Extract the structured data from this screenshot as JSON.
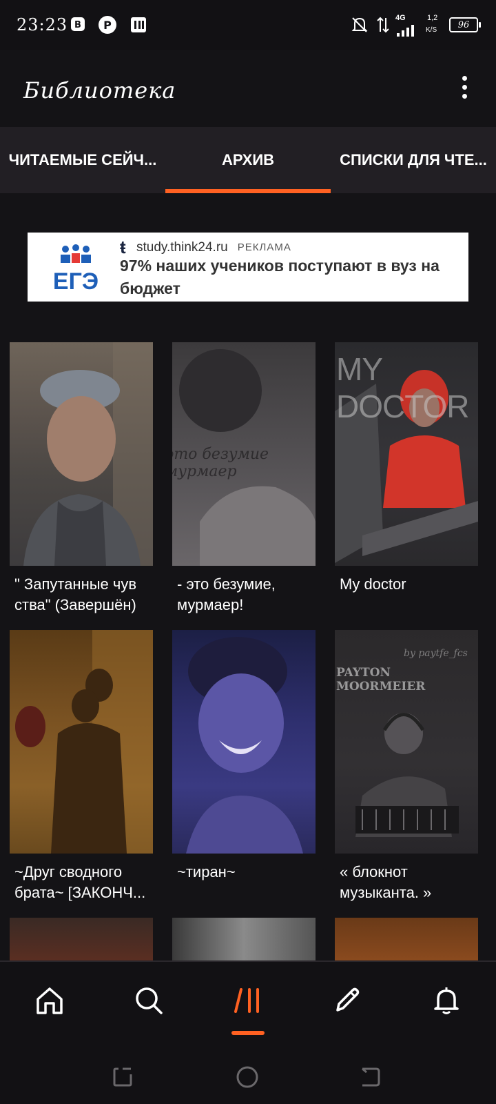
{
  "status_bar": {
    "time": "23:23",
    "network_speed": "1,2",
    "network_unit": "K/S",
    "signal_type": "4G",
    "battery": "96"
  },
  "header": {
    "title": "Библиотека"
  },
  "tabs": [
    {
      "label": "ЧИТАЕМЫЕ СЕЙЧ..."
    },
    {
      "label": "АРХИВ"
    },
    {
      "label": "СПИСКИ ДЛЯ ЧТЕ..."
    }
  ],
  "active_tab_index": 1,
  "ad": {
    "logo_text": "ЕГЭ",
    "domain": "study.think24.ru",
    "tag": "РЕКЛАМА",
    "text": "97% наших учеников поступают в вуз на бюджет"
  },
  "books": [
    {
      "title": "\" Запутанные чув ства\" (Завершён)"
    },
    {
      "title": "- это безумие, мурмаер!",
      "cover_text": "это безумие мурмаер"
    },
    {
      "title": "My doctor",
      "cover_text": "MY DOCTOR"
    },
    {
      "title": "~Друг сводного брата~ [ЗАКОНЧ..."
    },
    {
      "title": "~тиран~"
    },
    {
      "title": "« блокнот музыканта. »",
      "cover_text": "PAYTON MOORMEIER",
      "cover_subtext": "by paytfe_fcs"
    }
  ],
  "colors": {
    "accent": "#ff6122",
    "background": "#141316",
    "tabs_bg": "#221f24"
  },
  "bottom_nav": [
    "home-icon",
    "search-icon",
    "library-icon",
    "pencil-icon",
    "bell-icon"
  ],
  "active_nav": "library-icon"
}
